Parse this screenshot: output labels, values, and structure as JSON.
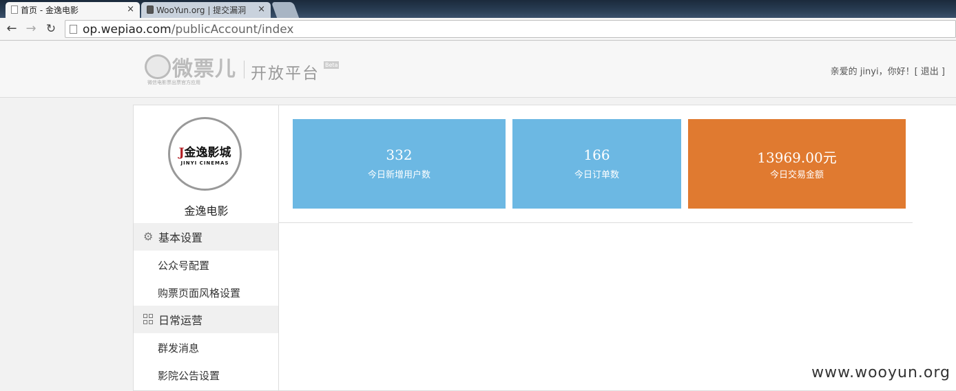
{
  "browser": {
    "tabs": [
      {
        "title": "首页 - 金逸电影",
        "active": true
      },
      {
        "title": "WooYun.org | 提交漏洞",
        "active": false
      }
    ],
    "close_glyph": "×",
    "url_host": "op.wepiao.com",
    "url_path": "/publicAccount/index"
  },
  "header": {
    "logo_text": "微票儿",
    "logo_sub": "微信电影票出票官方应用",
    "platform": "开放平台",
    "beta": "Beta",
    "greeting": "亲爱的 jinyi，你好！",
    "logout": "[ 退出 ]"
  },
  "sidebar": {
    "brand_mark": "金逸影城",
    "brand_en": "JINYI CINEMAS",
    "brand_name": "金逸电影",
    "groups": [
      {
        "label": "基本设置",
        "icon": "gear-icon",
        "items": [
          "公众号配置",
          "购票页面风格设置"
        ]
      },
      {
        "label": "日常运营",
        "icon": "grid-icon",
        "items": [
          "群发消息",
          "影院公告设置"
        ]
      }
    ]
  },
  "stats": [
    {
      "value": "332",
      "label": "今日新增用户数",
      "color": "#6cb8e3"
    },
    {
      "value": "166",
      "label": "今日订单数",
      "color": "#6cb8e3"
    },
    {
      "value": "13969.00元",
      "label": "今日交易金额",
      "color": "#e07a30"
    }
  ],
  "watermark": "www.wooyun.org"
}
